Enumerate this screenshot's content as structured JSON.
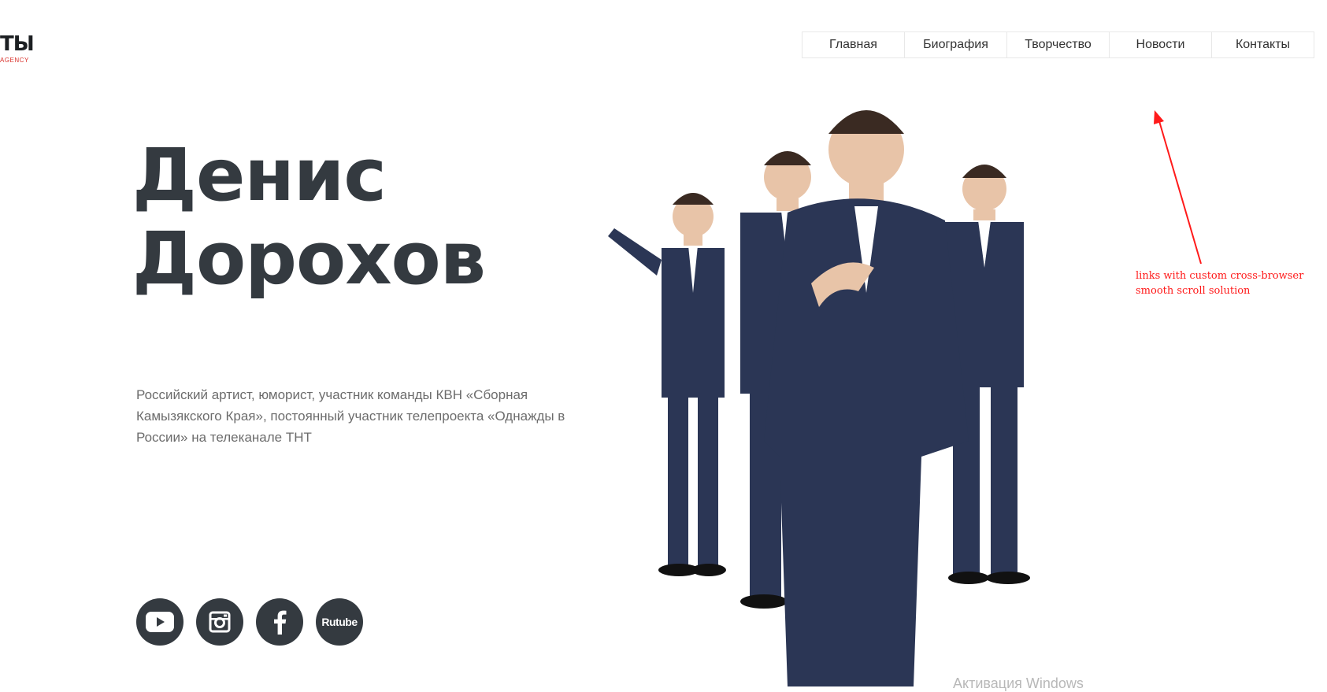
{
  "header": {
    "logo_text": "ТЫ",
    "logo_subtext": "AGENCY",
    "nav": [
      {
        "label": "Главная"
      },
      {
        "label": "Биография"
      },
      {
        "label": "Творчество"
      },
      {
        "label": "Новости"
      },
      {
        "label": "Контакты"
      }
    ]
  },
  "hero": {
    "name_line1": "Денис",
    "name_line2": "Дорохов",
    "description": "Российский артист, юморист, участник команды КВН «Сборная Камызякского Края», постоянный участник телепроекта «Однажды в России» на телеканале ТНТ"
  },
  "socials": [
    {
      "icon": "youtube-icon"
    },
    {
      "icon": "instagram-icon"
    },
    {
      "icon": "facebook-icon"
    },
    {
      "icon": "rutube-icon",
      "label": "Rutube"
    }
  ],
  "annotation": {
    "text": "links with custom cross-browser smooth scroll solution",
    "color": "#ff1a1a"
  },
  "watermark": "Активация Windows",
  "colors": {
    "text_dark": "#343a40",
    "text_muted": "#6c6c6c",
    "logo_accent": "#d9302a",
    "suit": "#2b3655"
  }
}
